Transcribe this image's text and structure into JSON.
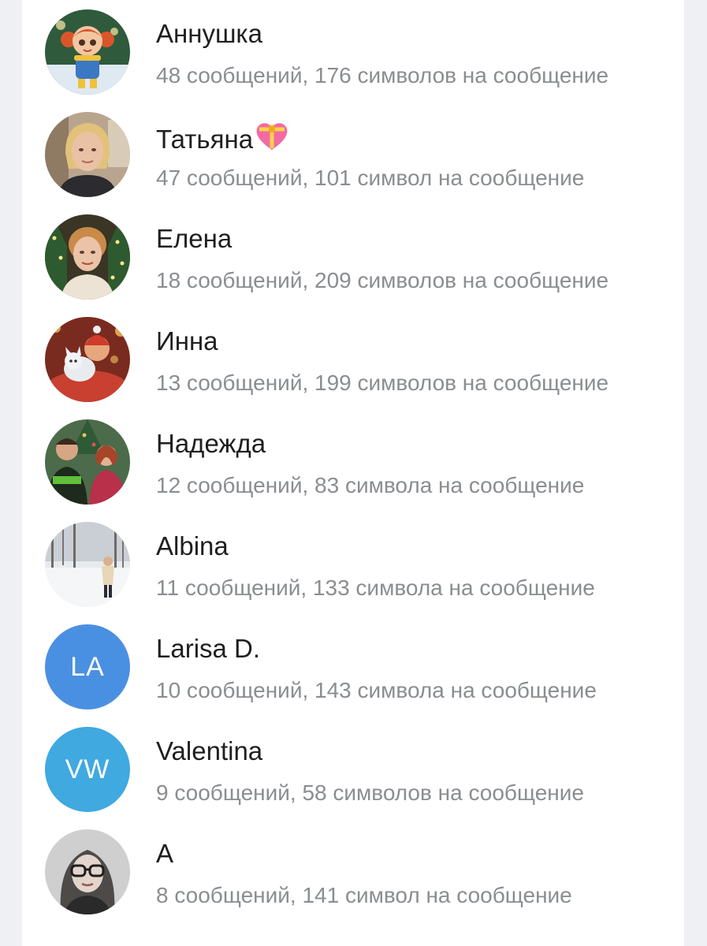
{
  "members": [
    {
      "name": "Аннушка",
      "stats": "48 сообщений, 176 символов на сообщение",
      "avatar_type": "photo",
      "avatar_icon": "cartoon-girl-avatar"
    },
    {
      "name": "Татьяна",
      "stats": "47 сообщений, 101 символ на сообщение",
      "avatar_type": "photo",
      "avatar_icon": "woman-portrait-avatar",
      "emoji": "💝"
    },
    {
      "name": "Елена",
      "stats": "18 сообщений, 209 символов на сообщение",
      "avatar_type": "photo",
      "avatar_icon": "woman-christmas-avatar"
    },
    {
      "name": "Инна",
      "stats": "13 сообщений, 199 символов на сообщение",
      "avatar_type": "photo",
      "avatar_icon": "knitted-toys-avatar"
    },
    {
      "name": "Надежда",
      "stats": "12 сообщений, 83 символа на сообщение",
      "avatar_type": "photo",
      "avatar_icon": "couple-photo-avatar"
    },
    {
      "name": "Albina",
      "stats": "11 сообщений, 133 символа на сообщение",
      "avatar_type": "photo",
      "avatar_icon": "winter-forest-avatar"
    },
    {
      "name": "Larisa D.",
      "stats": "10 сообщений, 143 символа на сообщение",
      "avatar_type": "initials",
      "initials": "LA",
      "avatar_color": "#4a90e2"
    },
    {
      "name": "Valentina",
      "stats": "9 сообщений, 58 символов на сообщение",
      "avatar_type": "initials",
      "initials": "VW",
      "avatar_color": "#3fa9e0"
    },
    {
      "name": "A",
      "stats": "8 сообщений, 141 символ на сообщение",
      "avatar_type": "photo",
      "avatar_icon": "woman-glasses-avatar"
    }
  ],
  "colors": {
    "name_text": "#1f1f1f",
    "stats_text": "#8a8d91",
    "background": "#eff0f3",
    "panel": "#ffffff"
  }
}
